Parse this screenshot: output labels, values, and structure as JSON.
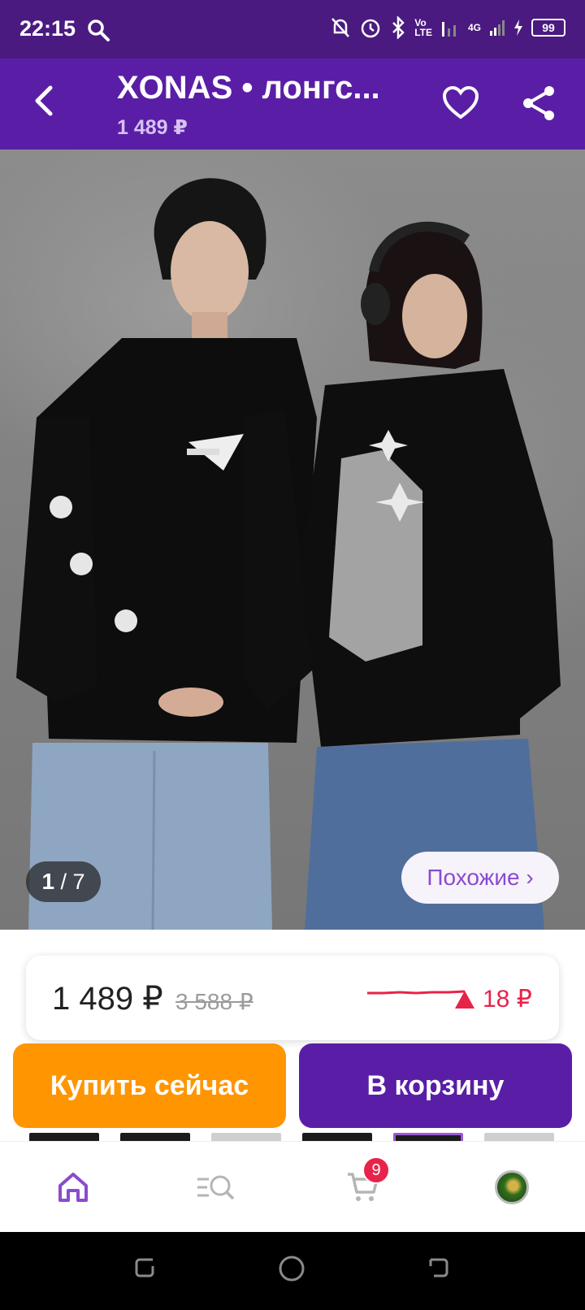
{
  "status_bar": {
    "time": "22:15",
    "network": "4G",
    "volte_top": "Vo",
    "volte_bottom": "LTE",
    "battery": "99"
  },
  "header": {
    "title": "XONAS • лонгс...",
    "price": "1 489 ₽"
  },
  "gallery": {
    "counter_current": "1",
    "counter_total": "/ 7",
    "similar_label": "Похожие ›"
  },
  "pricing": {
    "current": "1 489 ₽",
    "old": "3 588 ₽",
    "change": "18 ₽",
    "change_direction": "up",
    "change_color": "#e8234a"
  },
  "actions": {
    "buy_now": "Купить сейчас",
    "add_to_cart": "В корзину"
  },
  "bottom_nav": {
    "items": [
      {
        "icon": "home-icon",
        "active": true
      },
      {
        "icon": "catalog-search-icon",
        "active": false
      },
      {
        "icon": "cart-icon",
        "badge": "9",
        "active": false
      },
      {
        "icon": "profile-avatar",
        "active": false
      }
    ]
  },
  "colors": {
    "brand": "#5a1ea6",
    "status_bar": "#4a1a80",
    "buy": "#ff9500",
    "accent": "#9b59d8"
  }
}
